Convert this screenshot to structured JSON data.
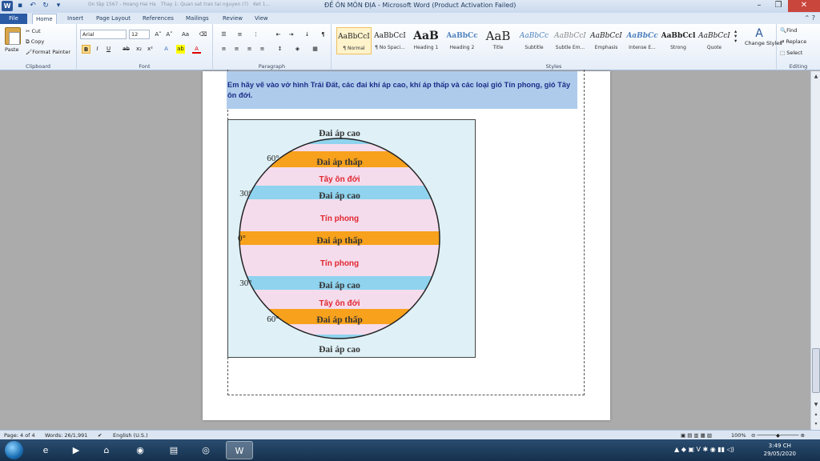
{
  "window": {
    "title": "ĐỀ ÔN MÔN ĐỊA - Microsoft Word (Product Activation Failed)",
    "background_tabs": [
      "Ôn tập 1567 - Hoang Hai Ha",
      "Thay 1: Quan sat tran tai nguyen (?)",
      "Ket 1..."
    ]
  },
  "tabs": [
    "File",
    "Home",
    "Insert",
    "Page Layout",
    "References",
    "Mailings",
    "Review",
    "View"
  ],
  "ribbon": {
    "clipboard": {
      "paste": "Paste",
      "cut": "Cut",
      "copy": "Copy",
      "format_painter": "Format Painter",
      "label": "Clipboard"
    },
    "font": {
      "name": "Arial",
      "size": "12",
      "label": "Font"
    },
    "paragraph": {
      "label": "Paragraph"
    },
    "styles": {
      "label": "Styles",
      "items": [
        {
          "sample": "AaBbCcI",
          "name": "¶ Normal"
        },
        {
          "sample": "AaBbCcI",
          "name": "¶ No Spaci..."
        },
        {
          "sample": "AaB",
          "name": "Heading 1"
        },
        {
          "sample": "AaBbCc",
          "name": "Heading 2"
        },
        {
          "sample": "AaB",
          "name": "Title"
        },
        {
          "sample": "AaBbCc",
          "name": "Subtitle"
        },
        {
          "sample": "AaBbCcI",
          "name": "Subtle Em..."
        },
        {
          "sample": "AaBbCcI",
          "name": "Emphasis"
        },
        {
          "sample": "AaBbCc",
          "name": "Intense E..."
        },
        {
          "sample": "AaBbCcl",
          "name": "Strong"
        },
        {
          "sample": "AaBbCcI",
          "name": "Quote"
        }
      ],
      "change_styles": "Change Styles"
    },
    "editing": {
      "find": "Find",
      "replace": "Replace",
      "select": "Select",
      "label": "Editing"
    }
  },
  "document": {
    "paragraph": "Em hãy vẽ vào vở hình Trái Đất, các đai khí áp cao, khí áp thấp và các loại gió Tín phong, gió Tây ôn đới.",
    "figure": {
      "bands": [
        {
          "label": "Đai áp cao",
          "color": "#8fd3ee"
        },
        {
          "label": "Đai áp thấp",
          "color": "#f7a11c"
        },
        {
          "label": "Tây ôn đới",
          "color": "#f5dcec"
        },
        {
          "label": "Đai áp cao",
          "color": "#8fd3ee"
        },
        {
          "label": "Tín phong",
          "color": "#f5dcec"
        },
        {
          "label": "Đai áp thấp",
          "color": "#f7a11c"
        },
        {
          "label": "Tín phong",
          "color": "#f5dcec"
        },
        {
          "label": "Đai áp cao",
          "color": "#8fd3ee"
        },
        {
          "label": "Tây ôn đới",
          "color": "#f5dcec"
        },
        {
          "label": "Đai áp thấp",
          "color": "#f7a11c"
        },
        {
          "label": "Đai áp cao",
          "color": "#8fd3ee"
        }
      ],
      "latitudes": [
        "60°",
        "30°",
        "0°",
        "30°",
        "60°"
      ]
    }
  },
  "status": {
    "page": "Page: 4 of 4",
    "words": "Words: 26/1,991",
    "language": "English (U.S.)",
    "zoom": "100%"
  },
  "taskbar": {
    "time": "3:49 CH",
    "date": "29/05/2020"
  }
}
